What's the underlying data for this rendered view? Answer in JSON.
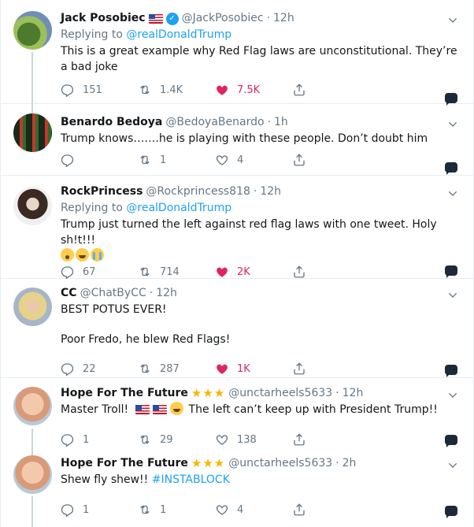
{
  "tweets": [
    {
      "name": "Jack Posobiec",
      "has_flag": true,
      "verified": true,
      "handle": "@JackPosobiec",
      "time": "12h",
      "replying_prefix": "Replying to",
      "replying_to": "@realDonaldTrump",
      "text": "This is a great example why Red Flag laws are unconstitutional. They’re a bad joke",
      "replies": "151",
      "retweets": "1.4K",
      "likes": "7.5K",
      "liked": true
    },
    {
      "name": "Benardo Bedoya",
      "handle": "@BedoyaBenardo",
      "time": "1h",
      "text": "Trump knows…….he is playing with these people. Don’t doubt him",
      "replies": "",
      "retweets": "1",
      "likes": "4",
      "liked": false
    },
    {
      "name": "RockPrincess",
      "handle": "@Rockprincess818",
      "time": "12h",
      "replying_prefix": "Replying to",
      "replying_to": "@realDonaldTrump",
      "text": "Trump just turned the left against red flag laws with one tweet. Holy sh!t!!!",
      "emojis": [
        "wow",
        "laugh",
        "cry"
      ],
      "replies": "67",
      "retweets": "714",
      "likes": "2K",
      "liked": true
    },
    {
      "name": "CC",
      "handle": "@ChatByCC",
      "time": "12h",
      "text_line1": "BEST POTUS EVER!",
      "text_line2": "Poor Fredo, he blew Red Flags!",
      "replies": "22",
      "retweets": "287",
      "likes": "1K",
      "liked": true
    },
    {
      "name": "Hope For The Future",
      "stars": "★★★",
      "handle": "@unctarheels5633",
      "time": "12h",
      "text_before": "Master Troll!",
      "text_after": "The left can’t keep up with President Trump!!",
      "replies": "1",
      "retweets": "29",
      "likes": "138",
      "liked": false
    },
    {
      "name": "Hope For The Future",
      "stars": "★★★",
      "handle": "@unctarheels5633",
      "time": "2h",
      "text": "Shew fly shew!!",
      "hashtag": "#INSTABLOCK",
      "replies": "1",
      "retweets": "1",
      "likes": "4",
      "liked": false
    }
  ],
  "separator": "·",
  "colors": {
    "accent": "#1da1f2",
    "like": "#e0245e",
    "muted": "#657786",
    "star": "#f5b700"
  },
  "icons": [
    "reply-icon",
    "retweet-icon",
    "like-icon",
    "share-icon",
    "caret-down-icon",
    "message-icon",
    "verified-icon"
  ]
}
